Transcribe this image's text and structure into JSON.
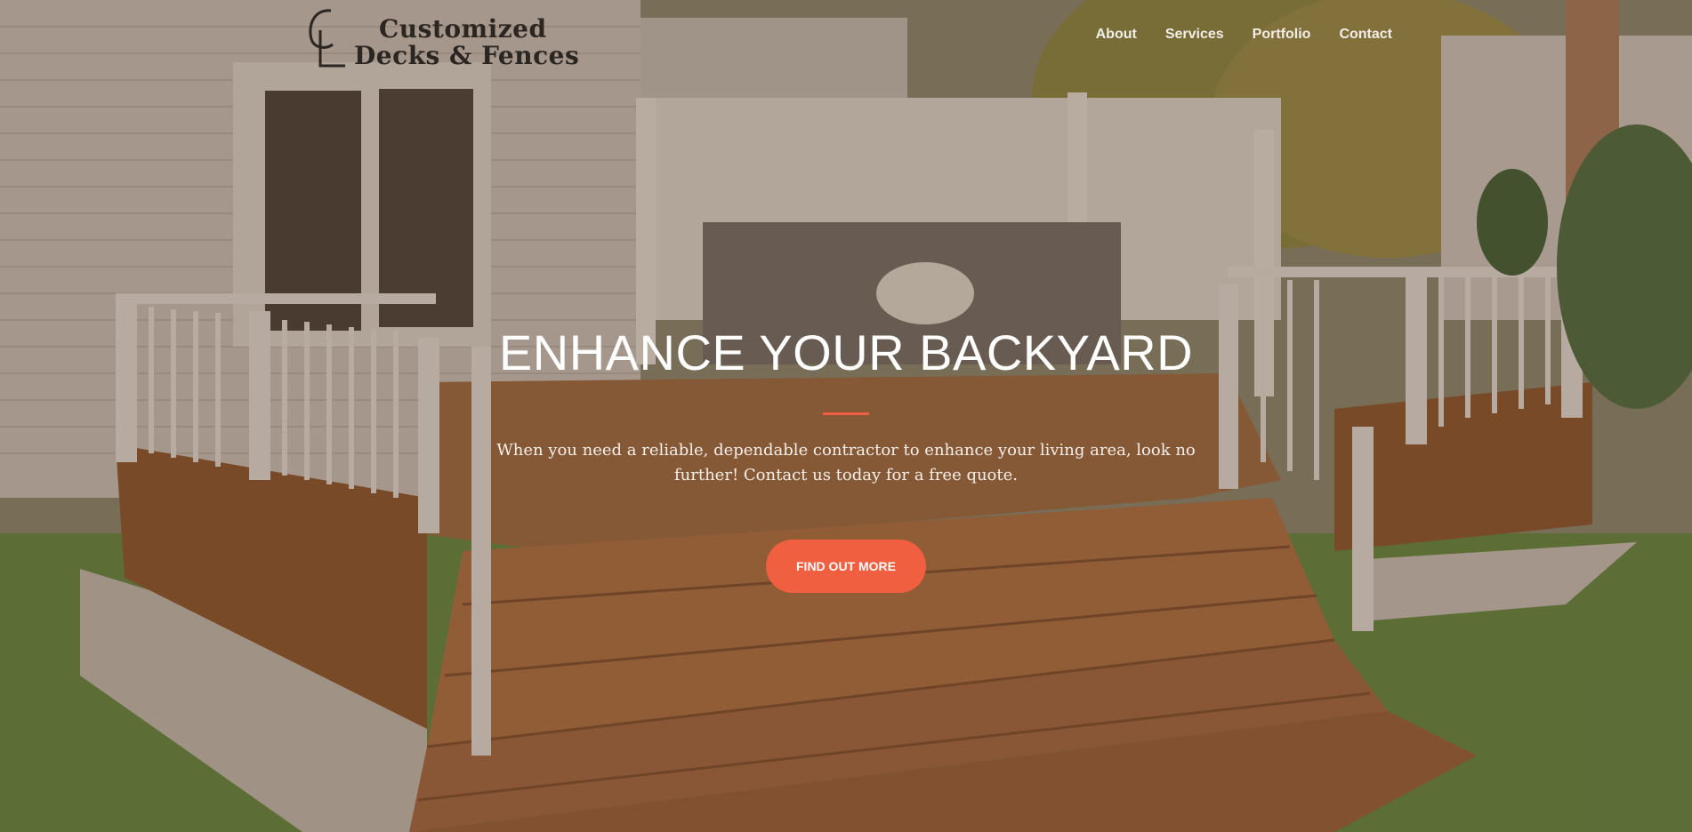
{
  "brand": {
    "line1": "Customized",
    "line2": "Decks & Fences",
    "mark": "CL"
  },
  "nav": {
    "items": [
      {
        "label": "About"
      },
      {
        "label": "Services"
      },
      {
        "label": "Portfolio"
      },
      {
        "label": "Contact"
      }
    ]
  },
  "hero": {
    "title": "ENHANCE YOUR BACKYARD",
    "text": "When you need a reliable, dependable contractor to enhance your living area, look no further! Contact us today for a free quote.",
    "cta_label": "FIND OUT MORE",
    "background_image": "deck-with-white-railing-photo"
  },
  "colors": {
    "accent": "#f05f40",
    "overlay": "rgba(95,70,50,0.42)"
  }
}
